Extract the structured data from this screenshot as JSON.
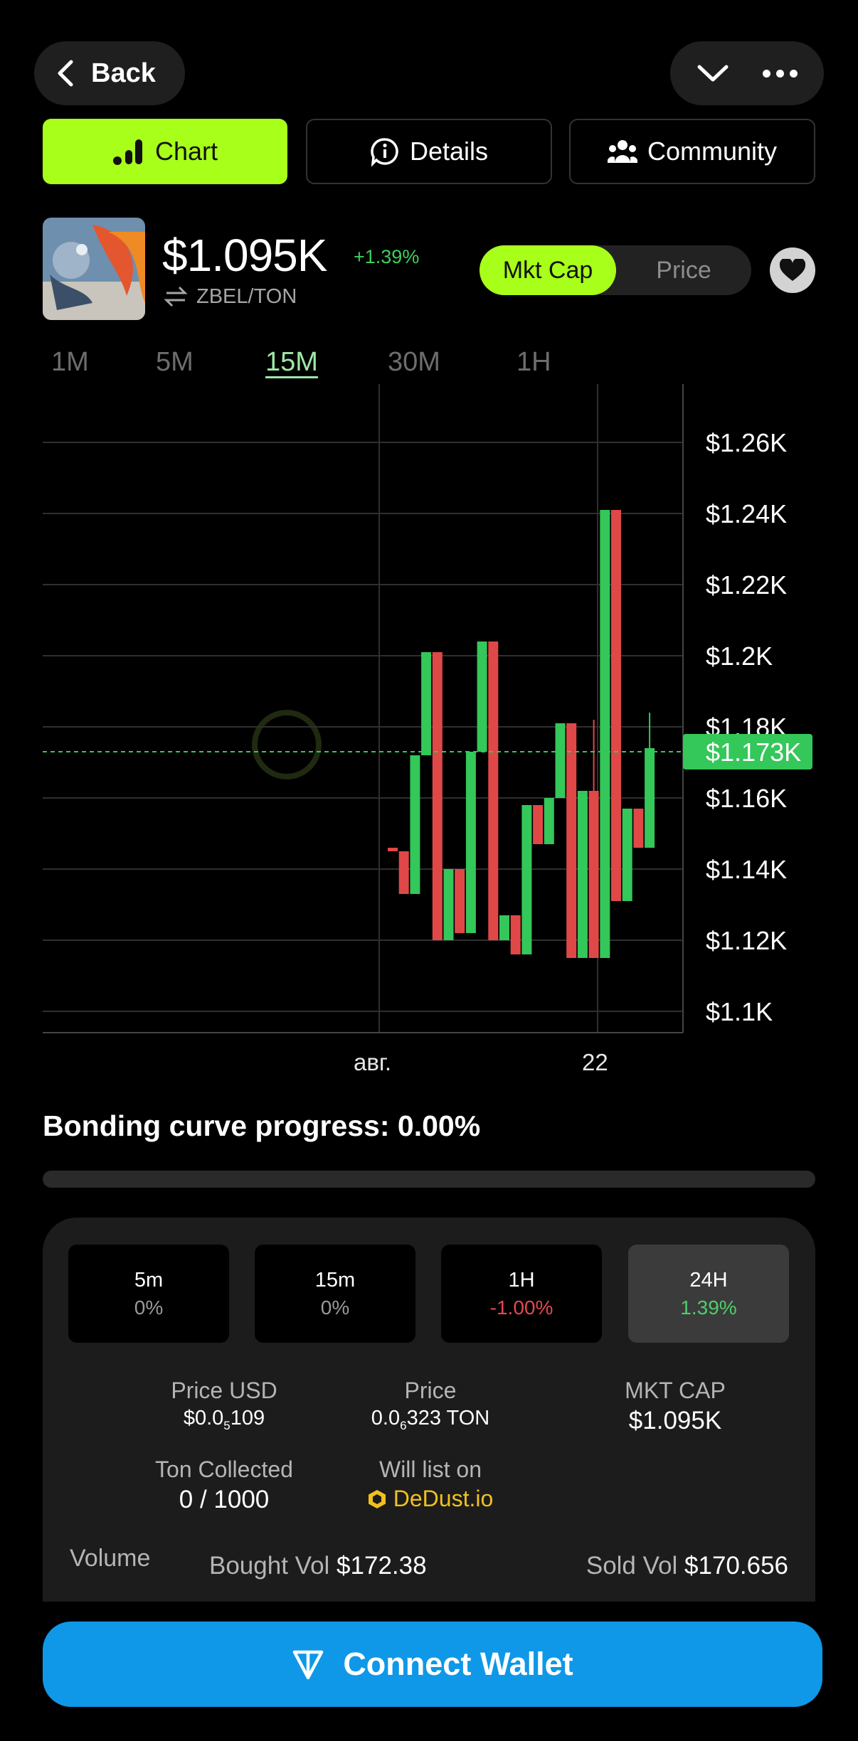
{
  "header": {
    "back_label": "Back"
  },
  "tabs": [
    {
      "label": "Chart",
      "icon": "bar-chart-icon",
      "active": true
    },
    {
      "label": "Details",
      "icon": "info-chat-icon",
      "active": false
    },
    {
      "label": "Community",
      "icon": "people-icon",
      "active": false
    }
  ],
  "token": {
    "price": "$1.095K",
    "change": "+1.39%",
    "pair": "ZBEL/TON",
    "toggle": {
      "selected": "Mkt Cap",
      "other": "Price"
    }
  },
  "timeframes": [
    "1M",
    "5M",
    "15M",
    "30M",
    "1H"
  ],
  "timeframe_selected": "15M",
  "chart_data": {
    "type": "candlestick",
    "y_ticks": [
      "$1.26K",
      "$1.24K",
      "$1.22K",
      "$1.2K",
      "$1.18K",
      "$1.16K",
      "$1.14K",
      "$1.12K",
      "$1.1K"
    ],
    "ylim": [
      1.095,
      1.275
    ],
    "x_ticks": [
      "авг.",
      "22"
    ],
    "current_value_label": "$1.173K",
    "current_value": 1.173,
    "colors": {
      "up": "#34c759",
      "down": "#e04848",
      "current": "#34c759"
    },
    "candles": [
      {
        "o": 1.146,
        "h": 1.146,
        "l": 1.145,
        "c": 1.145
      },
      {
        "o": 1.145,
        "h": 1.145,
        "l": 1.133,
        "c": 1.133
      },
      {
        "o": 1.133,
        "h": 1.172,
        "l": 1.133,
        "c": 1.172
      },
      {
        "o": 1.172,
        "h": 1.201,
        "l": 1.172,
        "c": 1.201
      },
      {
        "o": 1.201,
        "h": 1.201,
        "l": 1.12,
        "c": 1.12
      },
      {
        "o": 1.12,
        "h": 1.14,
        "l": 1.12,
        "c": 1.14
      },
      {
        "o": 1.14,
        "h": 1.14,
        "l": 1.122,
        "c": 1.122
      },
      {
        "o": 1.122,
        "h": 1.173,
        "l": 1.122,
        "c": 1.173
      },
      {
        "o": 1.173,
        "h": 1.204,
        "l": 1.173,
        "c": 1.204
      },
      {
        "o": 1.204,
        "h": 1.204,
        "l": 1.12,
        "c": 1.12
      },
      {
        "o": 1.12,
        "h": 1.127,
        "l": 1.12,
        "c": 1.127
      },
      {
        "o": 1.127,
        "h": 1.127,
        "l": 1.116,
        "c": 1.116
      },
      {
        "o": 1.116,
        "h": 1.158,
        "l": 1.116,
        "c": 1.158
      },
      {
        "o": 1.158,
        "h": 1.158,
        "l": 1.147,
        "c": 1.147
      },
      {
        "o": 1.147,
        "h": 1.16,
        "l": 1.147,
        "c": 1.16
      },
      {
        "o": 1.16,
        "h": 1.181,
        "l": 1.16,
        "c": 1.181
      },
      {
        "o": 1.181,
        "h": 1.181,
        "l": 1.115,
        "c": 1.115
      },
      {
        "o": 1.115,
        "h": 1.162,
        "l": 1.115,
        "c": 1.162
      },
      {
        "o": 1.162,
        "h": 1.182,
        "l": 1.115,
        "c": 1.115
      },
      {
        "o": 1.115,
        "h": 1.241,
        "l": 1.115,
        "c": 1.241
      },
      {
        "o": 1.241,
        "h": 1.241,
        "l": 1.131,
        "c": 1.131
      },
      {
        "o": 1.131,
        "h": 1.157,
        "l": 1.131,
        "c": 1.157
      },
      {
        "o": 1.157,
        "h": 1.157,
        "l": 1.146,
        "c": 1.146
      },
      {
        "o": 1.146,
        "h": 1.184,
        "l": 1.146,
        "c": 1.174
      }
    ]
  },
  "bonding": {
    "label": "Bonding curve progress: 0.00%",
    "progress": 0.0
  },
  "periods": [
    {
      "label": "5m",
      "value": "0%",
      "tone": "neutral"
    },
    {
      "label": "15m",
      "value": "0%",
      "tone": "neutral"
    },
    {
      "label": "1H",
      "value": "-1.00%",
      "tone": "red"
    },
    {
      "label": "24H",
      "value": "1.39%",
      "tone": "green",
      "selected": true
    }
  ],
  "stats": {
    "price_usd_label": "Price USD",
    "price_usd_value": "$0.0",
    "price_usd_sub": "5",
    "price_usd_tail": "109",
    "price_label": "Price",
    "price_value": "0.0",
    "price_sub": "6",
    "price_tail": "323 TON",
    "mktcap_label": "MKT CAP",
    "mktcap_value": "$1.095K",
    "ton_collected_label": "Ton Collected",
    "ton_collected_value": "0 / 1000",
    "will_list_label": "Will list on",
    "will_list_value": "DeDust.io"
  },
  "volume": {
    "label": "Volume",
    "bought_label": "Bought Vol",
    "bought_value": "$172.38",
    "sold_label": "Sold Vol",
    "sold_value": "$170.656"
  },
  "connect_label": "Connect Wallet"
}
